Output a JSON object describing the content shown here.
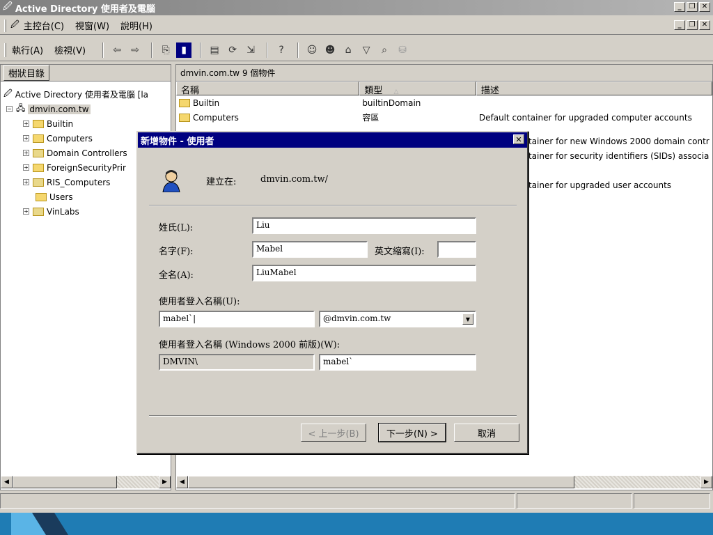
{
  "window": {
    "title": "Active Directory 使用者及電腦"
  },
  "menubar": {
    "items": [
      "主控台(C)",
      "視窗(W)",
      "說明(H)"
    ]
  },
  "toolbar": {
    "action": "執行(A)",
    "view": "檢視(V)"
  },
  "tree": {
    "header": "樹狀目錄",
    "root": "Active Directory 使用者及電腦 [la",
    "domain": "dmvin.com.tw",
    "items": [
      "Builtin",
      "Computers",
      "Domain Controllers",
      "ForeignSecurityPrir",
      "RIS_Computers",
      "Users",
      "VinLabs"
    ]
  },
  "list": {
    "header": "dmvin.com.tw   9 個物件",
    "columns": [
      "名稱",
      "類型",
      "描述"
    ],
    "rows": [
      {
        "name": "Builtin",
        "type": "builtinDomain",
        "desc": ""
      },
      {
        "name": "Computers",
        "type": "容區",
        "desc": "Default container for upgraded computer accounts"
      }
    ],
    "partial_desc": [
      "tainer for new Windows 2000 domain contr",
      "tainer for security identifiers (SIDs) associa",
      "tainer for upgraded user accounts"
    ]
  },
  "dialog": {
    "title": "新增物件 - 使用者",
    "create_in_label": "建立在:",
    "create_in_value": "dmvin.com.tw/",
    "last_name_label": "姓氏(L):",
    "last_name_value": "Liu",
    "first_name_label": "名字(F):",
    "first_name_value": "Mabel",
    "initials_label": "英文縮寫(I):",
    "initials_value": "",
    "full_name_label": "全名(A):",
    "full_name_value": "LiuMabel",
    "logon_label": "使用者登入名稱(U):",
    "logon_value": "mabel`|",
    "domain_suffix": "@dmvin.com.tw",
    "logon_pre2000_label": "使用者登入名稱 (Windows 2000 前版)(W):",
    "domain_prefix": "DMVIN\\",
    "logon_pre2000_value": "mabel`",
    "back_button": "< 上一步(B)",
    "next_button": "下一步(N) >",
    "cancel_button": "取消"
  }
}
